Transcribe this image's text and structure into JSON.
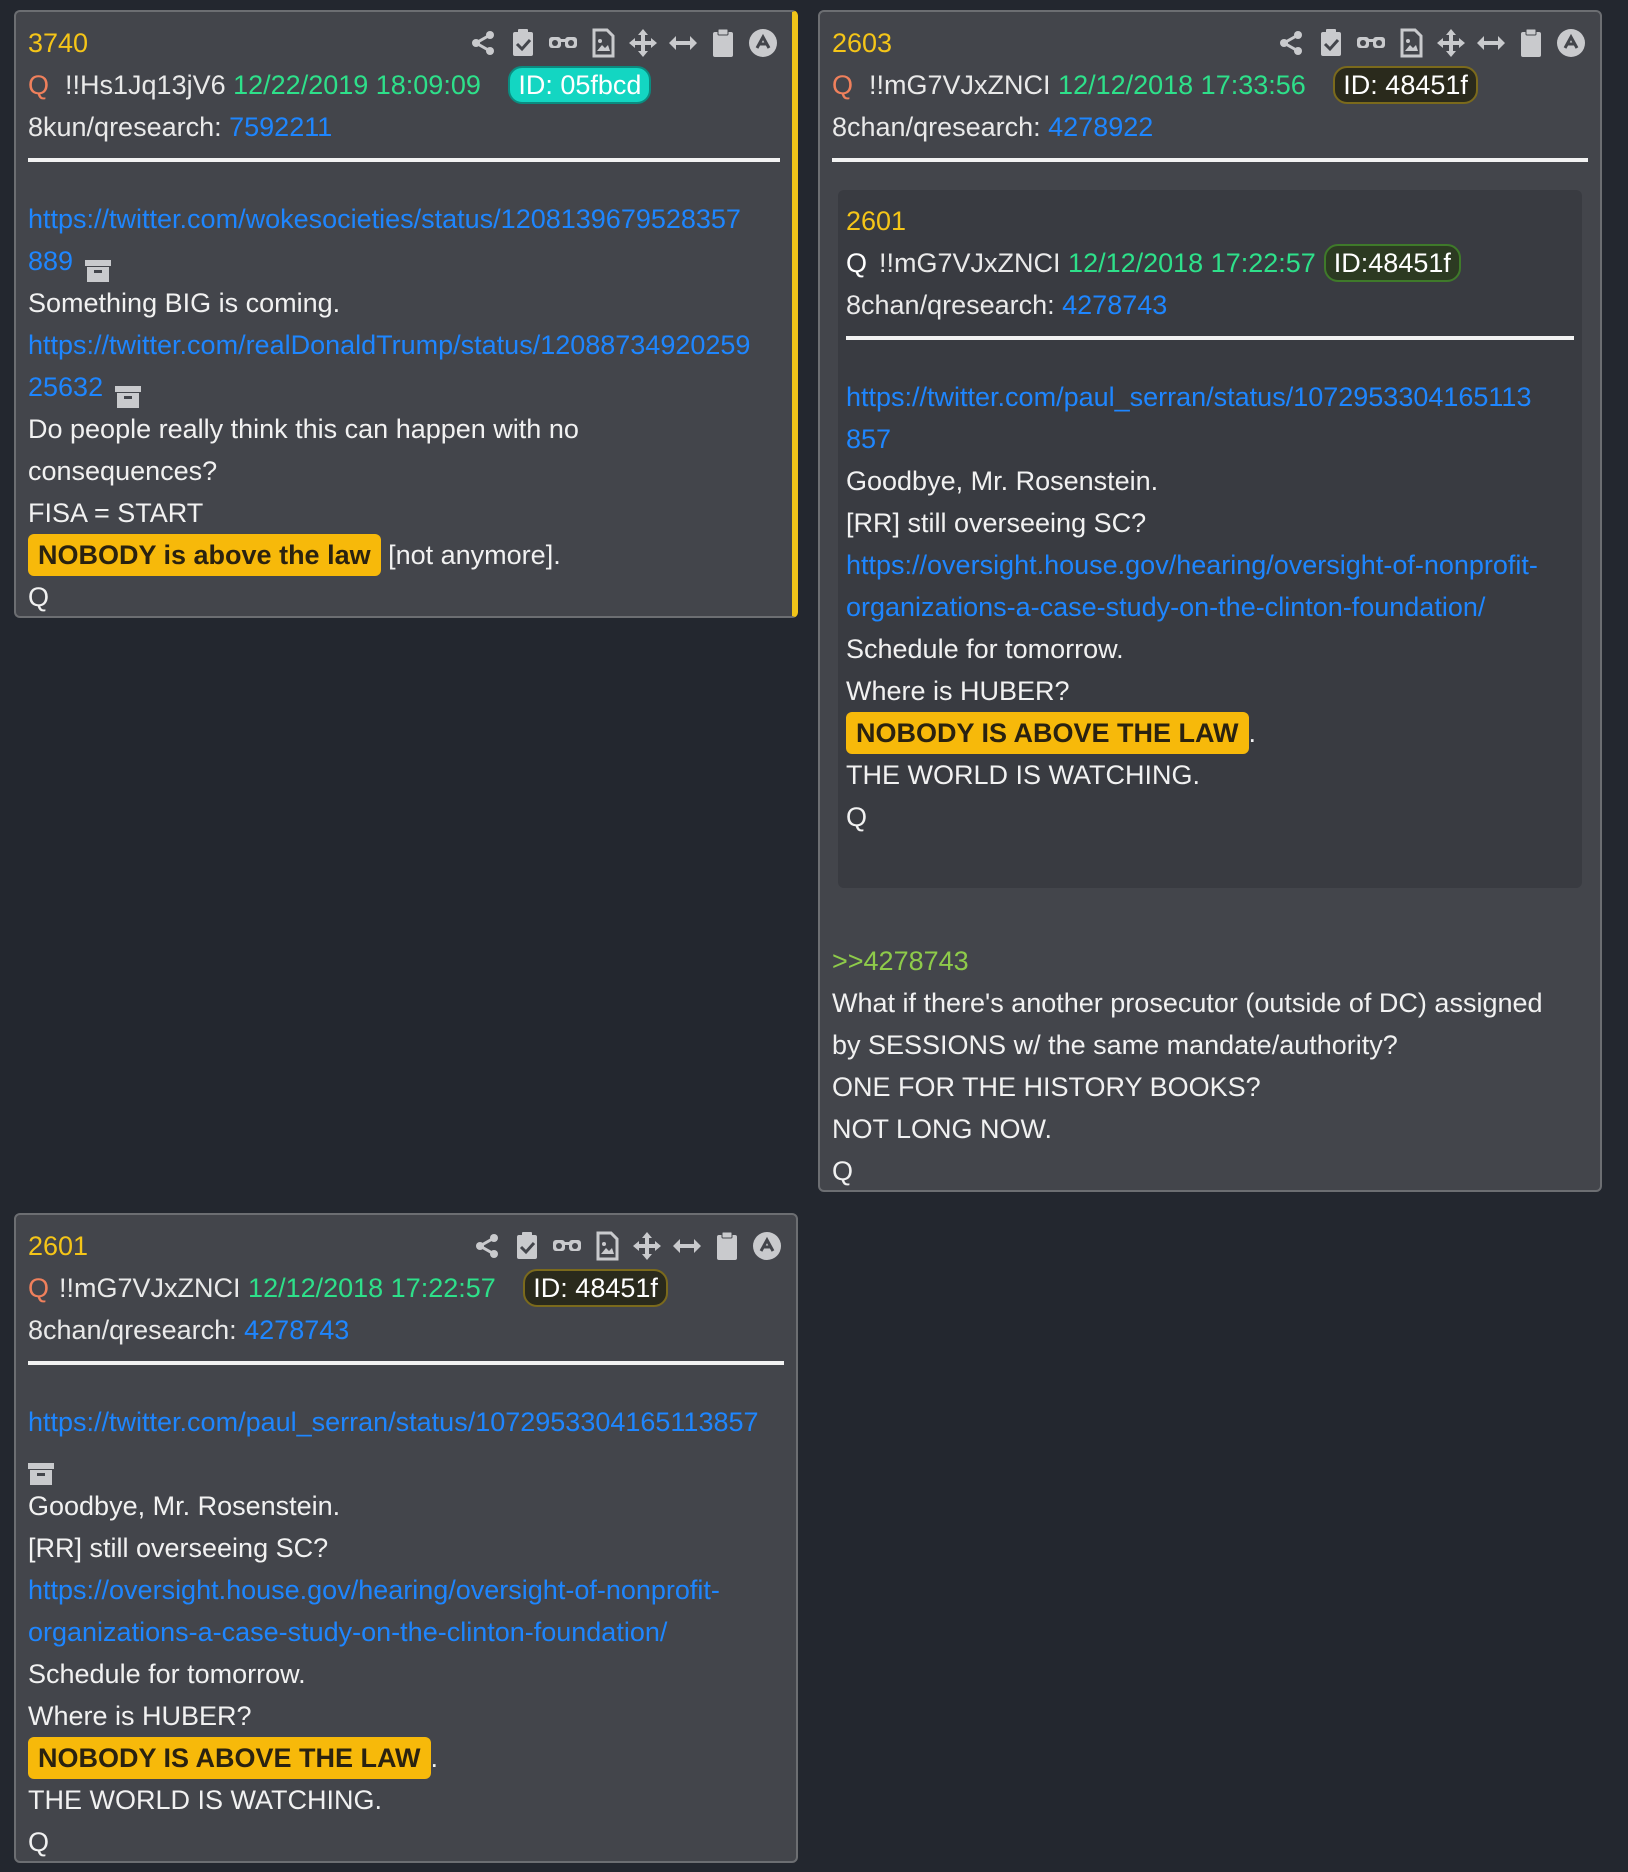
{
  "colors": {
    "page_bg": "#23272f",
    "card_bg": "#43454b",
    "number": "#f5c518",
    "date": "#2ee08a",
    "link": "#1e86ff",
    "highlight": "#f7b90a",
    "reply_link": "#8ecb4a"
  },
  "toolbar_icons": [
    "share-icon",
    "clipboard-check-icon",
    "glasses-icon",
    "image-file-icon",
    "move-icon",
    "resize-horizontal-icon",
    "clipboard-icon",
    "arrow-up-circle-icon"
  ],
  "post3740": {
    "number": "3740",
    "q": "Q",
    "trip": "!!Hs1Jq13jV6",
    "date": "12/22/2019 18:09:09",
    "id": "ID: 05fbcd",
    "board": "8kun/qresearch: ",
    "board_link": "7592211",
    "link1a": "https://twitter.com/wokesocieties/status/1208139679528357",
    "link1b": "889",
    "line1": "Something BIG is coming.",
    "link2a": "https://twitter.com/realDonaldTrump/status/12088734920259",
    "link2b": "25632",
    "line2": "Do people really think this can happen with no",
    "line3": "consequences?",
    "line4": "FISA = START",
    "highlight": "NOBODY is above the law",
    "after": " [not anymore].",
    "sign": "Q"
  },
  "post2603": {
    "number": "2603",
    "q": "Q",
    "trip": "!!mG7VJxZNCI",
    "date": "12/12/2018 17:33:56",
    "id": "ID: 48451f",
    "board": "8chan/qresearch: ",
    "board_link": "4278922",
    "quoted": {
      "number": "2601",
      "q": "Q",
      "trip": "!!mG7VJxZNCI",
      "date": "12/12/2018 17:22:57",
      "id": "ID:48451f",
      "board": "8chan/qresearch: ",
      "board_link": "4278743",
      "link1a": "https://twitter.com/paul_serran/status/1072953304165113",
      "link1b": "857",
      "line1": "Goodbye, Mr. Rosenstein.",
      "line2": "[RR] still overseeing SC?",
      "link2a": "https://oversight.house.gov/hearing/oversight-of-nonprofit-",
      "link2b": "organizations-a-case-study-on-the-clinton-foundation/",
      "line3": "Schedule for tomorrow.",
      "line4": "Where is HUBER?",
      "highlight": "NOBODY IS ABOVE THE LAW",
      "after": ".",
      "line5": "THE WORLD IS WATCHING.",
      "sign": "Q"
    },
    "reply": ">>4278743",
    "line1": "What if there's another prosecutor (outside of DC) assigned",
    "line2": "by SESSIONS w/ the same mandate/authority?",
    "line3": "ONE FOR THE HISTORY BOOKS?",
    "line4": "NOT LONG NOW.",
    "sign": "Q"
  },
  "post2601": {
    "number": "2601",
    "q": "Q",
    "trip": "!!mG7VJxZNCI",
    "date": "12/12/2018 17:22:57",
    "id": "ID: 48451f",
    "board": "8chan/qresearch: ",
    "board_link": "4278743",
    "link1": "https://twitter.com/paul_serran/status/1072953304165113857",
    "line1": "Goodbye, Mr. Rosenstein.",
    "line2": "[RR] still overseeing SC?",
    "link2a": "https://oversight.house.gov/hearing/oversight-of-nonprofit-",
    "link2b": "organizations-a-case-study-on-the-clinton-foundation/",
    "line3": "Schedule for tomorrow.",
    "line4": "Where is HUBER?",
    "highlight": "NOBODY IS ABOVE THE LAW",
    "after": ".",
    "line5": "THE WORLD IS WATCHING.",
    "sign": "Q"
  }
}
